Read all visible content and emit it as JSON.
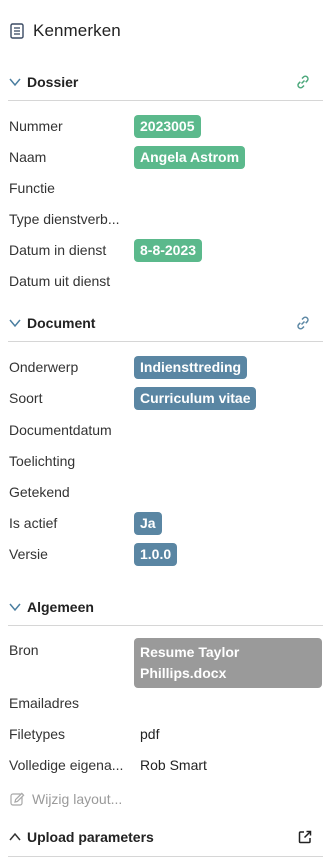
{
  "panel": {
    "title": "Kenmerken",
    "icon": "document-icon"
  },
  "colors": {
    "green": "#5bb98c",
    "blue": "#5a86a3",
    "gray": "#9a9a9a",
    "link_green": "#4aa77a",
    "link_blue": "#5a86a3"
  },
  "dossier": {
    "title": "Dossier",
    "fields": [
      {
        "label": "Nummer",
        "value": "2023005"
      },
      {
        "label": "Naam",
        "value": "Angela Astrom"
      },
      {
        "label": "Functie",
        "value": ""
      },
      {
        "label": "Type dienstverb...",
        "value": ""
      },
      {
        "label": "Datum in dienst",
        "value": "8-8-2023"
      },
      {
        "label": "Datum uit dienst",
        "value": ""
      }
    ]
  },
  "document": {
    "title": "Document",
    "fields": [
      {
        "label": "Onderwerp",
        "value": "Indiensttreding"
      },
      {
        "label": "Soort",
        "value": "Curriculum vitae"
      },
      {
        "label": "Documentdatum",
        "value": ""
      },
      {
        "label": "Toelichting",
        "value": ""
      },
      {
        "label": "Getekend",
        "value": ""
      },
      {
        "label": "Is actief",
        "value": "Ja"
      },
      {
        "label": "Versie",
        "value": "1.0.0"
      }
    ]
  },
  "algemeen": {
    "title": "Algemeen",
    "fields": [
      {
        "label": "Bron",
        "value": "Resume Taylor Phillips.docx"
      },
      {
        "label": "Emailadres",
        "value": ""
      },
      {
        "label": "Filetypes",
        "value": "pdf"
      },
      {
        "label": "Volledige eigena...",
        "value": "Rob Smart"
      }
    ]
  },
  "wijzig_layout": "Wijzig layout...",
  "upload": {
    "title": "Upload parameters"
  }
}
